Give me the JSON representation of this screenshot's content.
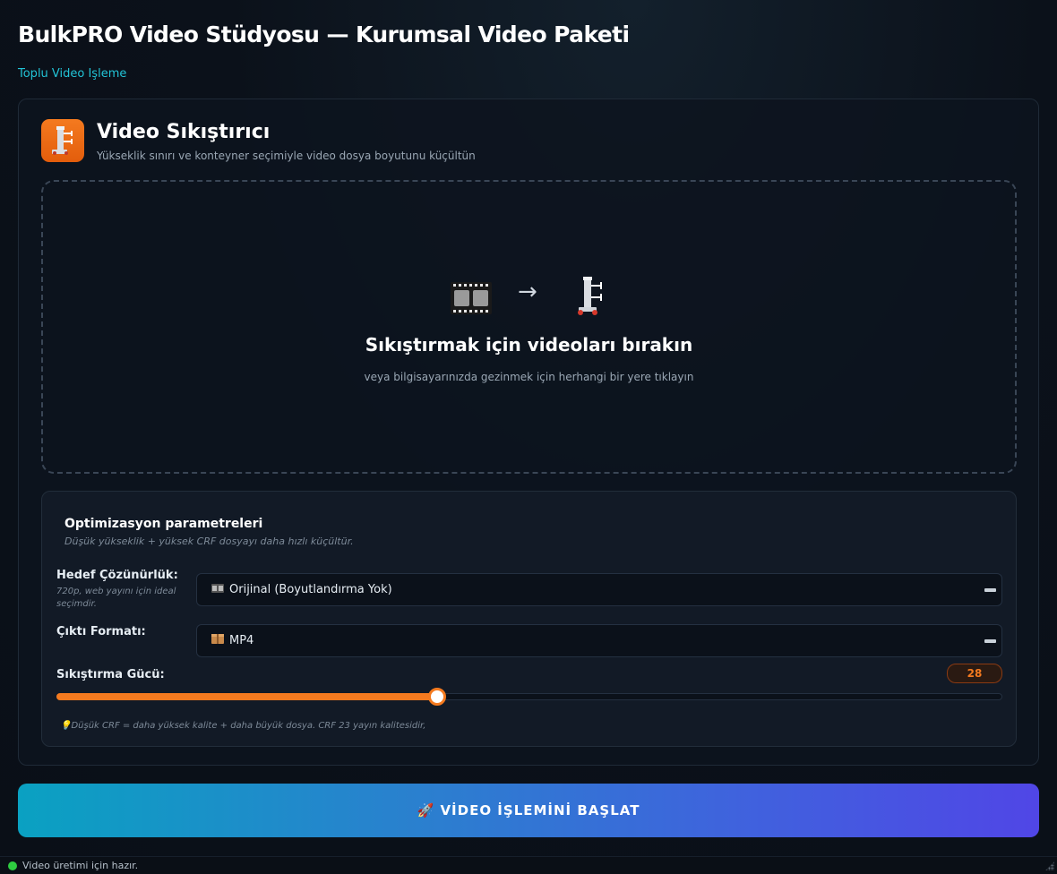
{
  "app": {
    "title": "BulkPRO Video Stüdyosu — Kurumsal Video Paketi",
    "subtitle": "Toplu Video Işleme"
  },
  "tool": {
    "icon": "clamp-icon",
    "title": "Video Sıkıştırıcı",
    "description": "Yükseklik sınırı ve konteyner seçimiyle video dosya boyutunu küçültün"
  },
  "dropzone": {
    "icons": [
      "film-strip-icon",
      "arrow-right-icon",
      "clamp-icon"
    ],
    "arrow": "→",
    "title": "Sıkıştırmak için videoları bırakın",
    "hint": "veya bilgisayarınızda gezinmek için herhangi bir yere tıklayın"
  },
  "params": {
    "title": "Optimizasyon parametreleri",
    "note": "Düşük yükseklik + yüksek CRF dosyayı daha hızlı küçültür.",
    "resolution": {
      "label": "Hedef Çözünürlük:",
      "help": "720p, web yayını için ideal seçimdir.",
      "icon": "film-frames-icon",
      "value": "Orijinal (Boyutlandırma Yok)"
    },
    "format": {
      "label": "Çıktı Formatı:",
      "icon": "package-icon",
      "value": "MP4"
    },
    "compression": {
      "label": "Sıkıştırma Gücü:",
      "value": "28",
      "fraction": 0.402
    },
    "tip": "💡Düşük CRF = daha yüksek kalite + daha büyük dosya. CRF 23 yayın kalitesidir,"
  },
  "start_button": {
    "icon": "rocket-icon",
    "label": "🚀 VİDEO İŞLEMİNİ BAŞLAT"
  },
  "status": {
    "text": "Video üretimi için hazır.",
    "color": "#2ecc40"
  },
  "colors": {
    "accent": "#f47a1f",
    "cyan": "#22c3d6",
    "button_start": "#0aa1c2",
    "button_end": "#5046e6"
  }
}
